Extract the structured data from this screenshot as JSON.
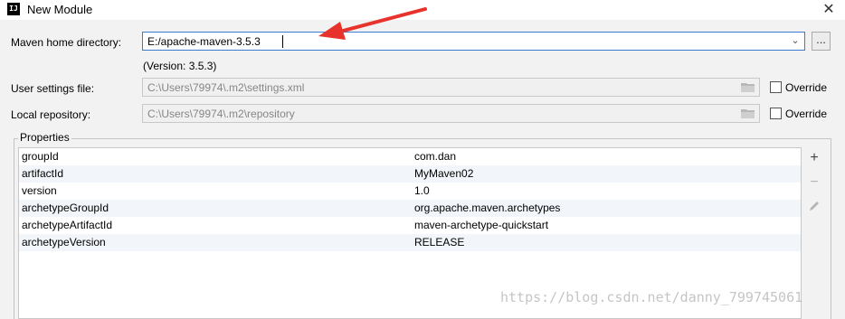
{
  "window": {
    "title": "New Module",
    "app_icon": "IJ"
  },
  "maven_home": {
    "label": "Maven home directory:",
    "value": "E:/apache-maven-3.5.3",
    "version_note": "(Version: 3.5.3)",
    "browse_label": "..."
  },
  "user_settings": {
    "label": "User settings file:",
    "value": "C:\\Users\\79974\\.m2\\settings.xml",
    "override_label": "Override"
  },
  "local_repo": {
    "label": "Local repository:",
    "value": "C:\\Users\\79974\\.m2\\repository",
    "override_label": "Override"
  },
  "properties": {
    "title": "Properties",
    "rows": [
      {
        "key": "groupId",
        "value": "com.dan"
      },
      {
        "key": "artifactId",
        "value": "MyMaven02"
      },
      {
        "key": "version",
        "value": "1.0"
      },
      {
        "key": "archetypeGroupId",
        "value": "org.apache.maven.archetypes"
      },
      {
        "key": "archetypeArtifactId",
        "value": "maven-archetype-quickstart"
      },
      {
        "key": "archetypeVersion",
        "value": "RELEASE"
      }
    ],
    "tools": [
      "plus-icon",
      "minus-icon",
      "edit-icon"
    ]
  },
  "watermark": "https://blog.csdn.net/danny_799745061",
  "colors": {
    "focus_border": "#3b7bd0",
    "annotation_arrow": "#e8322c"
  }
}
